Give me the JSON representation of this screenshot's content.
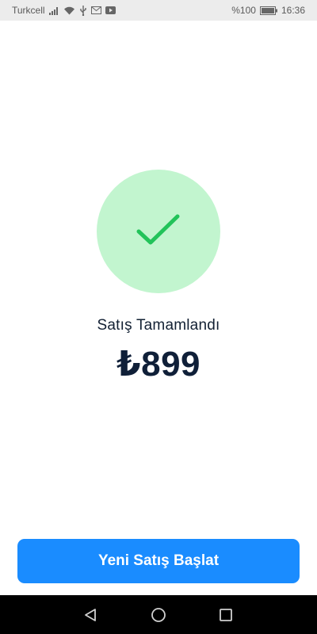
{
  "status_bar": {
    "carrier": "Turkcell",
    "battery_percent": "%100",
    "time": "16:36",
    "icons": [
      "signal-icon",
      "wifi-icon",
      "usb-icon",
      "mail-icon",
      "youtube-icon",
      "battery-icon"
    ]
  },
  "result": {
    "title": "Satış Tamamlandı",
    "amount": "₺899",
    "icon": "check-icon",
    "circle_color": "#c2f5cf",
    "check_color": "#22c35a"
  },
  "actions": {
    "new_sale_label": "Yeni Satış Başlat",
    "button_color": "#1a8cff"
  },
  "navigation": {
    "buttons": [
      "back-icon",
      "home-icon",
      "recents-icon"
    ]
  }
}
